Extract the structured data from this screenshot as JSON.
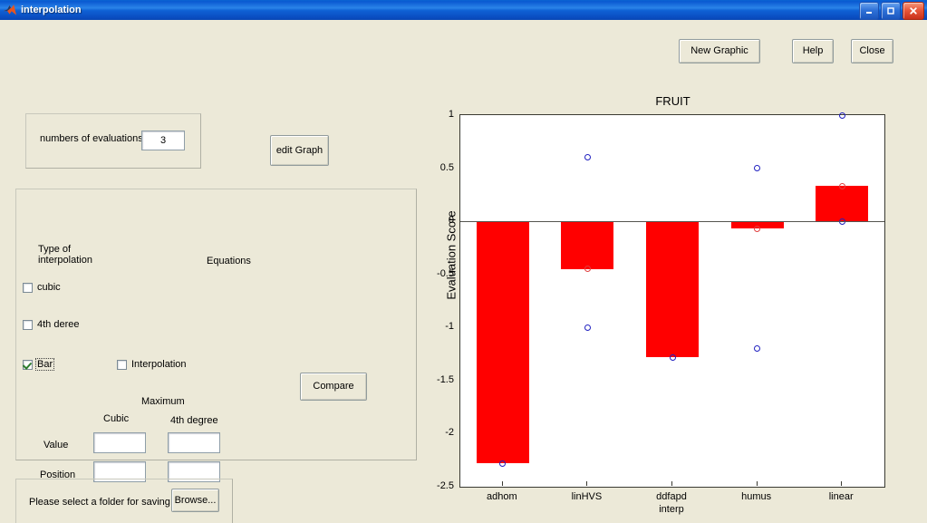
{
  "window": {
    "title": "interpolation",
    "icon": "matlab-icon",
    "controls": {
      "minimize": "minimize-icon",
      "maximize": "maximize-icon",
      "close": "close-icon"
    }
  },
  "toolbar": {
    "new_graphic_label": "New Graphic",
    "help_label": "Help",
    "close_label": "Close"
  },
  "evaluations_panel": {
    "label": "numbers of evaluations :",
    "value": "3"
  },
  "edit_graph_label": "edit Graph",
  "interpolation_panel": {
    "type_header": "Type of\ninterpolation",
    "equations_header": "Equations",
    "checkboxes": [
      {
        "label": "cubic",
        "checked": false
      },
      {
        "label": "4th deree",
        "checked": false
      },
      {
        "label": "Bar",
        "checked": true,
        "focused": true
      },
      {
        "label": "Interpolation",
        "checked": false
      }
    ],
    "compare_label": "Compare",
    "maximum": {
      "header": "Maximum",
      "columns": [
        "Cubic",
        "4th degree"
      ],
      "rows": [
        {
          "label": "Value",
          "cubic": "",
          "fourth": ""
        },
        {
          "label": "Position",
          "cubic": "",
          "fourth": ""
        }
      ]
    }
  },
  "save_panel": {
    "label": "Please select a folder for saving data",
    "browse_label": "Browse..."
  },
  "chart_data": {
    "type": "bar",
    "title": "FRUIT",
    "xlabel": "",
    "ylabel": "Evaluation Score",
    "categories": [
      "adhom",
      "linHVS",
      "ddfapd\ninterp",
      "humus",
      "linear"
    ],
    "values": [
      -2.28,
      -0.45,
      -1.28,
      -0.07,
      0.33
    ],
    "bar_color": "#ff0000",
    "ylim": [
      -2.5,
      1
    ],
    "yticks": [
      1,
      0.5,
      0,
      -0.5,
      -1,
      -1.5,
      -2,
      -2.5
    ],
    "ytick_labels": [
      "1",
      "0.5",
      "0",
      "-0.5",
      "-1",
      "-1.5",
      "-2",
      "-2.5"
    ],
    "grid": false,
    "legend": "none",
    "markers": [
      {
        "category": "adhom",
        "x_index": 0,
        "y": -2.28,
        "color": "#2020c0",
        "shape": "circle"
      },
      {
        "category": "linHVS",
        "x_index": 1,
        "y": 0.6,
        "color": "#2020c0",
        "shape": "circle"
      },
      {
        "category": "linHVS",
        "x_index": 1,
        "y": -1.0,
        "color": "#2020c0",
        "shape": "circle"
      },
      {
        "category": "linHVS",
        "x_index": 1,
        "y": -0.45,
        "color": "#e04040",
        "shape": "circle"
      },
      {
        "category": "ddfapd",
        "x_index": 2,
        "y": -1.28,
        "color": "#2020c0",
        "shape": "circle"
      },
      {
        "category": "humus",
        "x_index": 3,
        "y": 0.5,
        "color": "#2020c0",
        "shape": "circle"
      },
      {
        "category": "humus",
        "x_index": 3,
        "y": -1.2,
        "color": "#2020c0",
        "shape": "circle"
      },
      {
        "category": "humus",
        "x_index": 3,
        "y": -0.07,
        "color": "#e04040",
        "shape": "circle"
      },
      {
        "category": "linear",
        "x_index": 4,
        "y": 1.0,
        "color": "#2020c0",
        "shape": "circle"
      },
      {
        "category": "linear",
        "x_index": 4,
        "y": 0.0,
        "color": "#2020c0",
        "shape": "circle"
      },
      {
        "category": "linear",
        "x_index": 4,
        "y": 0.33,
        "color": "#e04040",
        "shape": "circle"
      }
    ]
  }
}
